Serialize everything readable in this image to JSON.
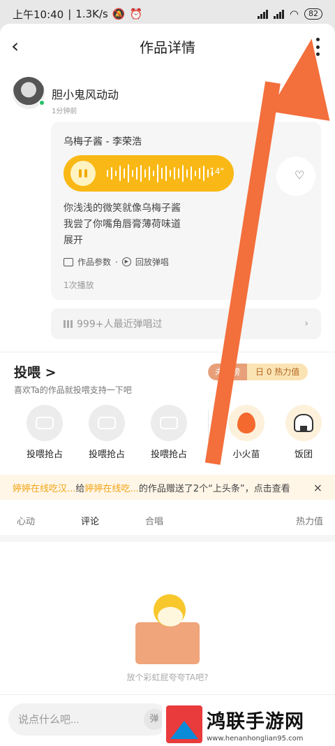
{
  "status_bar": {
    "time": "上午10:40",
    "speed": "1.3K/s",
    "battery": "82"
  },
  "header": {
    "title": "作品详情"
  },
  "user": {
    "name": "胆小鬼风动动",
    "time": "1分钟前"
  },
  "work": {
    "song": "乌梅子酱 - 李荣浩",
    "duration": "14\"",
    "lyrics": [
      "你浅浅的微笑就像乌梅子酱",
      "我尝了你嘴角唇膏薄荷味道",
      "展开"
    ],
    "params": "作品参数",
    "replay": "回放弹唱",
    "plays": "1次播放",
    "recent_sang": "999+人最近弹唱过"
  },
  "feed": {
    "title": "投喂",
    "chevron": ">",
    "subtitle": "喜欢Ta的作品就投喂支持一下吧",
    "rank_status": "未上榜",
    "rank_value": "日 0 热力值",
    "gifts": [
      {
        "label": "投喂抢占"
      },
      {
        "label": "投喂抢占"
      },
      {
        "label": "投喂抢占"
      },
      {
        "label": "小火苗"
      },
      {
        "label": "饭团"
      }
    ]
  },
  "notice": {
    "from": "婷婷在线吃汉...",
    "give": "给",
    "to": "婷婷在线吃...",
    "text": "的作品赠送了2个“上头条”，点击查看"
  },
  "tabs": {
    "heart": "心动",
    "comment": "评论",
    "chorus": "合唱",
    "heat": "热力值"
  },
  "empty": {
    "text": "放个彩虹屁夸夸TA吧?"
  },
  "comment_bar": {
    "placeholder": "说点什么吧...",
    "danmu": "弹"
  },
  "watermark": {
    "cn": "鸿联手游网",
    "url": "www.henanhonglian95.com"
  }
}
